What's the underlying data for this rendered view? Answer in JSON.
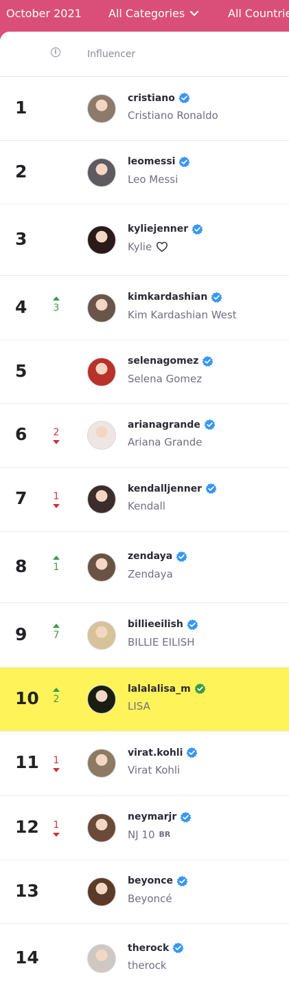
{
  "filters": {
    "month": "October 2021",
    "category": "All Categories",
    "country": "All Countries"
  },
  "table_header": {
    "influencer_label": "Influencer",
    "info_icon": "info-icon"
  },
  "colors": {
    "brand": "#d94f79",
    "highlight": "#fff35a",
    "verified_blue": "#3897f0",
    "verified_green": "#3a9a4a",
    "rank_up": "#3a9a4a",
    "rank_down": "#c9333a"
  },
  "rows": [
    {
      "rank": "1",
      "change": "",
      "direction": "",
      "handle": "cristiano",
      "name": "Cristiano Ronaldo",
      "avatar": "#8c7a6a"
    },
    {
      "rank": "2",
      "change": "",
      "direction": "",
      "handle": "leomessi",
      "name": "Leo Messi",
      "avatar": "#5e5a60"
    },
    {
      "rank": "3",
      "change": "",
      "direction": "",
      "handle": "kyliejenner",
      "name": "Kylie",
      "name_icon": "heart-outline-icon",
      "avatar": "#2a1b1a"
    },
    {
      "rank": "4",
      "change": "3",
      "direction": "up",
      "handle": "kimkardashian",
      "name": "Kim Kardashian West",
      "avatar": "#6b5448"
    },
    {
      "rank": "5",
      "change": "",
      "direction": "",
      "handle": "selenagomez",
      "name": "Selena Gomez",
      "avatar": "#b8322a"
    },
    {
      "rank": "6",
      "change": "2",
      "direction": "down",
      "handle": "arianagrande",
      "name": "Ariana Grande",
      "avatar": "#efe6e4"
    },
    {
      "rank": "7",
      "change": "1",
      "direction": "down",
      "handle": "kendalljenner",
      "name": "Kendall",
      "avatar": "#3b2e2a"
    },
    {
      "rank": "8",
      "change": "1",
      "direction": "up",
      "handle": "zendaya",
      "name": "Zendaya",
      "avatar": "#6a5343"
    },
    {
      "rank": "9",
      "change": "7",
      "direction": "up",
      "handle": "billieeilish",
      "name": "BILLIE EILISH",
      "avatar": "#d8c29a"
    },
    {
      "rank": "10",
      "change": "2",
      "direction": "up",
      "handle": "lalalalisa_m",
      "name": "LISA",
      "avatar": "#1a1e12",
      "highlight": true,
      "verified_color": "green"
    },
    {
      "rank": "11",
      "change": "1",
      "direction": "down",
      "handle": "virat.kohli",
      "name": "Virat Kohli",
      "avatar": "#8d7a64"
    },
    {
      "rank": "12",
      "change": "1",
      "direction": "down",
      "handle": "neymarjr",
      "name": "NJ 10",
      "name_suffix": "BR",
      "avatar": "#6a4a38"
    },
    {
      "rank": "13",
      "change": "",
      "direction": "",
      "handle": "beyonce",
      "name": "Beyoncé",
      "avatar": "#5a3a28"
    },
    {
      "rank": "14",
      "change": "",
      "direction": "",
      "handle": "therock",
      "name": "therock",
      "avatar": "#cfc8c2"
    }
  ]
}
